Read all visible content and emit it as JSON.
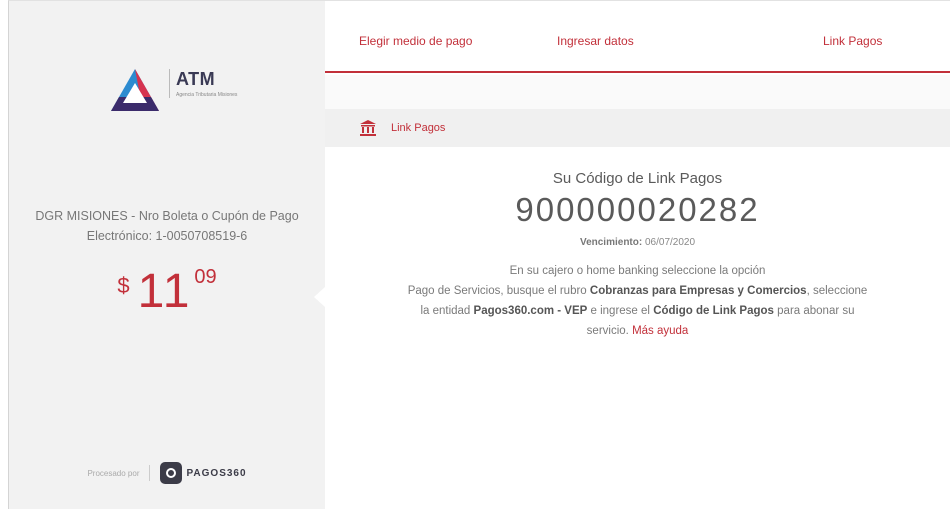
{
  "logo": {
    "title": "ATM",
    "subtitle": "Agencia Tributaria Misiones"
  },
  "payment": {
    "description": "DGR MISIONES - Nro Boleta o Cupón de Pago Electrónico: 1-0050708519-6",
    "currency": "$",
    "amount_int": "11",
    "amount_dec": "09"
  },
  "processed_by": {
    "label": "Procesado por",
    "brand": "PAGOS360"
  },
  "tabs": [
    {
      "label": "Elegir medio de pago"
    },
    {
      "label": "Ingresar datos"
    },
    {
      "label": "Link Pagos"
    }
  ],
  "section": {
    "icon": "bank-icon",
    "title": "Link Pagos"
  },
  "result": {
    "title": "Su Código de Link Pagos",
    "code": "900000020282",
    "expiry_label": "Vencimiento:",
    "expiry_value": "06/07/2020",
    "p1": "En su cajero o home banking seleccione la opción",
    "p2": "Pago de Servicios, busque el rubro",
    "p2_bold": "Cobranzas para Empresas y",
    "p3_bold": "Comercios",
    "p3": ", seleccione la entidad",
    "p3_entity": "Pagos360.com - VEP",
    "p3_end": "e ingrese el",
    "p4_bold": "Código de Link Pagos",
    "p4": "para abonar su servicio.",
    "help_link": "Más ayuda"
  },
  "colors": {
    "accent": "#c2303a",
    "panel": "#f2f2f2"
  }
}
